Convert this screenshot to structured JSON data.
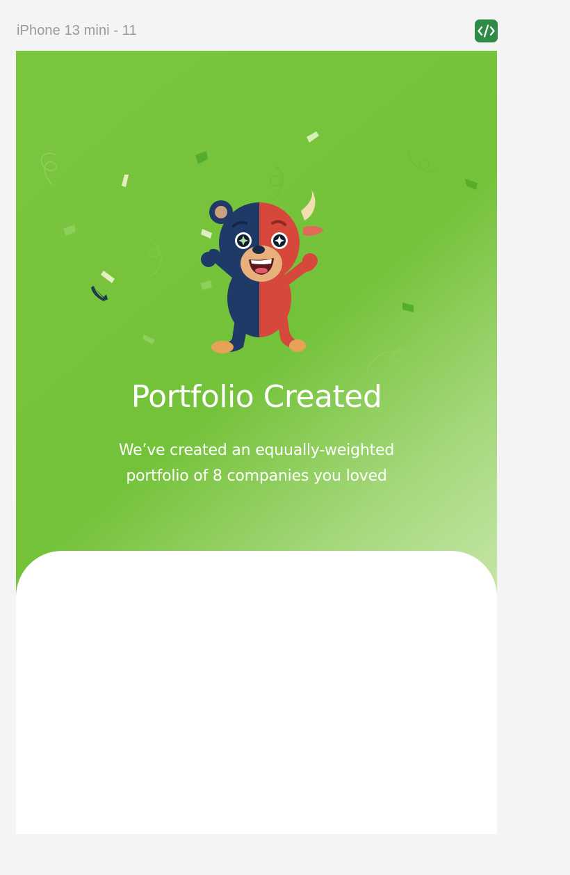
{
  "frame": {
    "label": "iPhone 13 mini - 11",
    "code_icon": "code-icon"
  },
  "screen": {
    "title": "Portfolio Created",
    "subtitle_line1": "We’ve created an equually-weighted",
    "subtitle_line2": "portfolio of 8 companies you loved",
    "mascot": "bear-bull-mascot-icon"
  },
  "colors": {
    "canvas_background": "#f4f4f4",
    "gradient_green": "#74c23a",
    "gradient_light": "#e6f5da",
    "badge_green": "#2e8b47",
    "bear_navy": "#1f3a66",
    "bull_red": "#d6473c",
    "sheet_white": "#ffffff"
  }
}
